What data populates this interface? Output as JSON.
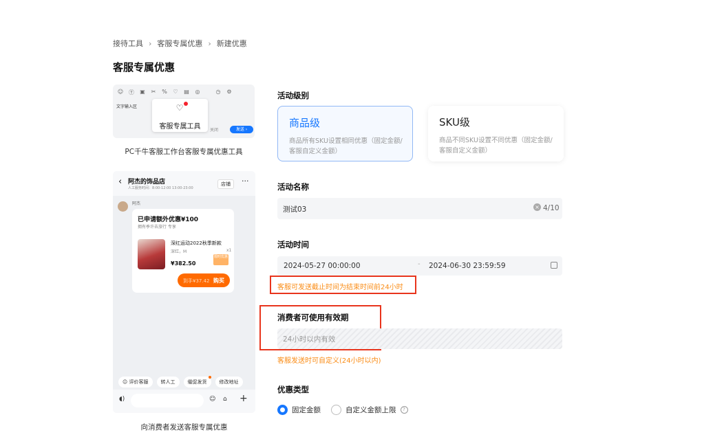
{
  "breadcrumb": [
    "接待工具",
    "客服专属优惠",
    "新建优惠"
  ],
  "breadcrumb_sep": "›",
  "page_title": "客服专属优惠",
  "pc_preview": {
    "input_area_label": "文字输入区",
    "tooltip_label": "客服专属工具",
    "close_label": "关闭",
    "send_label": "发送 ›",
    "caption": "PC千牛客服工作台客服专属优惠工具"
  },
  "phone_preview": {
    "shop_name": "阿杰的饰品店",
    "shop_sub": "人工服务时间：8:00-12:00 13:00-23:00",
    "store_btn": "店铺",
    "agent_name": "阿杰",
    "coupon_title": "已申请额外优惠¥100",
    "coupon_sub": "拥有季许去旅行 专享",
    "product_name": "深红运动2022秋季新款",
    "product_spec": "深红，M",
    "product_qty": "x1",
    "product_price": "¥382.50",
    "product_tag": "限时优惠",
    "buy_price": "到手¥37.42",
    "buy_label": "购买",
    "quick_actions": [
      "☺ 评价客服",
      "转人工",
      "催促发货",
      "修改地址"
    ],
    "caption": "向消费者发送客服专属优惠"
  },
  "form": {
    "level_label": "活动级别",
    "level_options": [
      {
        "title": "商品级",
        "desc": "商品所有SKU设置相同优惠（固定金额/客服自定义金额）",
        "selected": true
      },
      {
        "title": "SKU级",
        "desc": "商品不同SKU设置不同优惠（固定金额/客服自定义金额）",
        "selected": false
      }
    ],
    "name_label": "活动名称",
    "name_value": "测试03",
    "name_count": "4/10",
    "time_label": "活动时间",
    "time_start": "2024-05-27 00:00:00",
    "time_sep": "-",
    "time_end": "2024-06-30 23:59:59",
    "time_hint": "客服可发送截止时间为结束时间前24小时",
    "validity_label": "消费者可使用有效期",
    "validity_value": "24小时以内有效",
    "validity_hint": "客服发送时可自定义(24小时以内)",
    "type_label": "优惠类型",
    "type_options": [
      "固定金额",
      "自定义金额上限"
    ],
    "type_selected": "固定金额",
    "help_icon_label": "?"
  },
  "colors": {
    "accent": "#1677ff",
    "warning": "#fa8c16",
    "highlight_box": "#e8341c",
    "buy": "#ff6a00"
  }
}
